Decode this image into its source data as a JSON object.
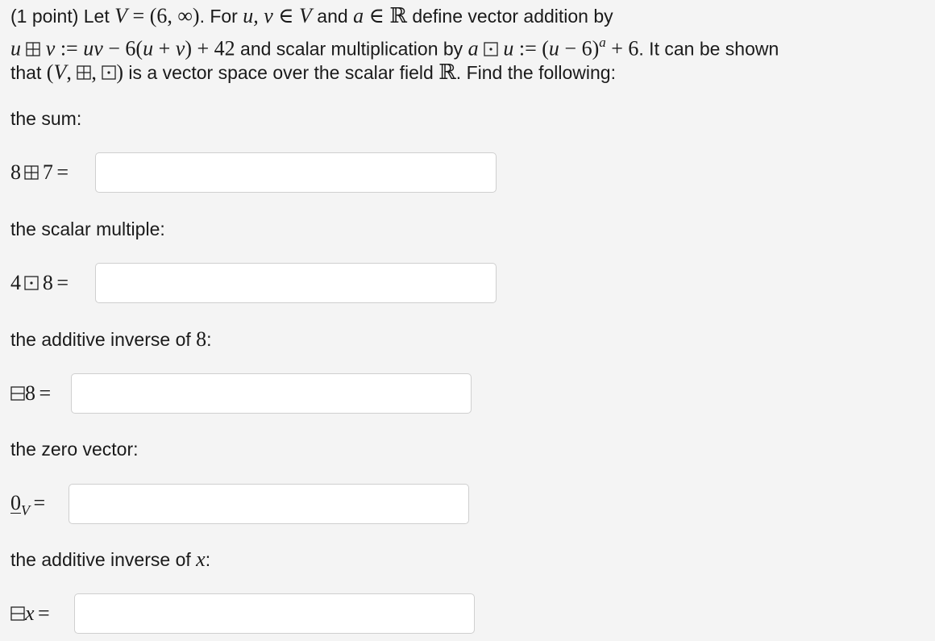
{
  "problem": {
    "points": "(1 point)",
    "let": "Let",
    "V": "V",
    "eq": " = ",
    "interval": "(6, ∞)",
    "dot_for": ". For",
    "uv_list": "u, v",
    "in": " ∈ ",
    "V2": "V",
    "and_word": " and ",
    "a": "a",
    "in2": " ∈ ",
    "reals": "ℝ",
    "define_addition": " define vector addition by",
    "u": "u",
    "v": "v",
    "assign": " := ",
    "uv_prod": "uv",
    "minus_six": " − 6(",
    "u2": "u",
    "plus": " + ",
    "v2": "v",
    "close_plus_42": ") + 42",
    "scalar_text": " and scalar multiplication by ",
    "a2": "a",
    "u3": "u",
    "assign2": " := ",
    "open": "(",
    "u4": "u",
    "minus_six2": " − 6)",
    "exp_a": "a",
    "plus_six": " + 6",
    "it_can_be_shown": ". It can be shown",
    "that": "that ",
    "tuple_open": "(",
    "V3": "V",
    "comma": ", ",
    "comma2": ", ",
    "tuple_close": ")",
    "is_vector_space": " is a vector space over the scalar field ",
    "reals2": "ℝ",
    "find_following": ". Find the following:"
  },
  "questions": [
    {
      "label": "the sum:",
      "lhs_left": "8",
      "lhs_right": "7",
      "equals": "=",
      "answer_value": ""
    },
    {
      "label": "the scalar multiple:",
      "lhs_left": "4",
      "lhs_right": "8",
      "equals": "=",
      "answer_value": ""
    },
    {
      "label": "the additive inverse of ",
      "label_math": "8",
      "label_end": ":",
      "lhs_right": "8",
      "equals": "=",
      "answer_value": ""
    },
    {
      "label": "the zero vector:",
      "zero": "0",
      "zero_sub": "V",
      "equals": "=",
      "answer_value": ""
    },
    {
      "label": "the additive inverse of ",
      "label_math": "x",
      "label_end": ":",
      "lhs_right": "x",
      "equals": "=",
      "answer_value": ""
    }
  ],
  "icons": {
    "boxplus": "boxplus-icon",
    "boxdot": "boxdot-icon",
    "boxminus": "boxminus-icon"
  }
}
